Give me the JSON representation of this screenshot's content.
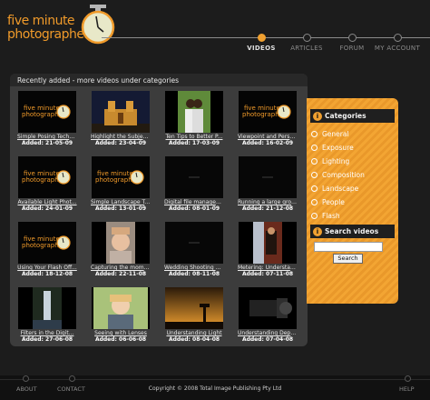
{
  "logo": {
    "line1": "five minute",
    "line2": "photographer"
  },
  "nav": [
    {
      "label": "VIDEOS",
      "active": true
    },
    {
      "label": "ARTICLES",
      "active": false
    },
    {
      "label": "FORUM",
      "active": false
    },
    {
      "label": "MY ACCOUNT",
      "active": false
    }
  ],
  "main": {
    "header": "Recently added - more videos under categories",
    "videos": [
      {
        "title": "Simple Posing Techni...",
        "added": "Added: 21-05-09",
        "thumb": "logo"
      },
      {
        "title": "Highlight the Subjec...",
        "added": "Added: 23-04-09",
        "thumb": "church"
      },
      {
        "title": "Ten Tips to Better P...",
        "added": "Added: 17-03-09",
        "thumb": "couple"
      },
      {
        "title": "Viewpoint and Perspe...",
        "added": "Added: 16-02-09",
        "thumb": "logo"
      },
      {
        "title": "Available Light Phot...",
        "added": "Added: 24-01-09",
        "thumb": "logo"
      },
      {
        "title": "Simple Landscape Tech...",
        "added": "Added: 13-01-09",
        "thumb": "logo"
      },
      {
        "title": "Digital file managem...",
        "added": "Added: 08-01-09",
        "thumb": "dark"
      },
      {
        "title": "Running a large grou...",
        "added": "Added: 21-12-08",
        "thumb": "dark"
      },
      {
        "title": "Using Your Flash Off...",
        "added": "Added: 18-12-08",
        "thumb": "logo"
      },
      {
        "title": "Capturing the moment",
        "added": "Added: 22-11-08",
        "thumb": "child"
      },
      {
        "title": "Wedding Shooting S...",
        "added": "Added: 08-11-08",
        "thumb": "dark"
      },
      {
        "title": "Metering: Understand...",
        "added": "Added: 07-11-08",
        "thumb": "photographer"
      },
      {
        "title": "Filters in the Digit...",
        "added": "Added: 27-06-08",
        "thumb": "falls"
      },
      {
        "title": "Seeing with Lenses",
        "added": "Added: 06-06-08",
        "thumb": "woman"
      },
      {
        "title": "Understanding Light",
        "added": "Added: 08-04-08",
        "thumb": "sunset"
      },
      {
        "title": "Understanding Depth...",
        "added": "Added: 07-04-08",
        "thumb": "lens"
      }
    ]
  },
  "sidebar": {
    "categories_title": "Categories",
    "categories": [
      "General",
      "Exposure",
      "Lighting",
      "Composition",
      "Landscape",
      "People",
      "Flash"
    ],
    "search_title": "Search videos",
    "search_value": "",
    "search_button": "Search"
  },
  "footer": {
    "links": [
      "ABOUT",
      "CONTACT",
      "HELP"
    ],
    "copyright": "Copyright © 2008 Total Image Publishing Pty Ltd"
  },
  "colors": {
    "accent": "#f0a030",
    "panel": "#3c3c3c",
    "background": "#1c1c1c"
  }
}
